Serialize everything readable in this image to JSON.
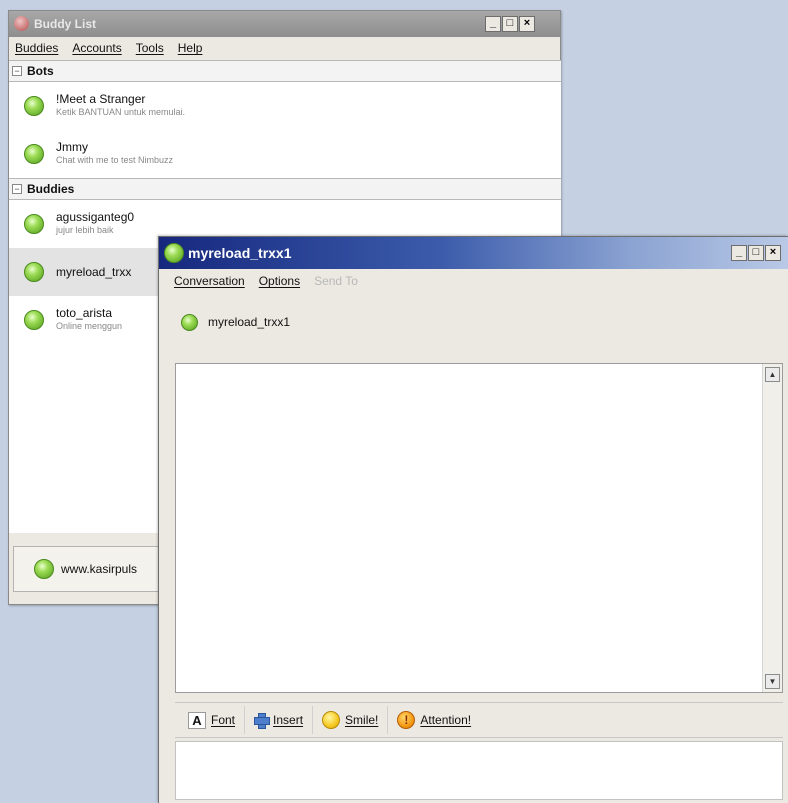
{
  "buddy_list_window": {
    "title": "Buddy List",
    "controls": {
      "minimize": "_",
      "maximize": "□",
      "close": "×"
    },
    "menu": [
      "Buddies",
      "Accounts",
      "Tools",
      "Help"
    ],
    "groups": [
      {
        "name": "Bots",
        "collapse_glyph": "−",
        "buddies": [
          {
            "name": "!Meet a Stranger",
            "status": "Ketik BANTUAN untuk memulai."
          },
          {
            "name": "Jmmy",
            "status": "Chat with me to test Nimbuzz"
          }
        ]
      },
      {
        "name": "Buddies",
        "collapse_glyph": "−",
        "buddies": [
          {
            "name": "agussiganteg0",
            "status": "jujur lebih baik"
          },
          {
            "name": "myreload_trxx",
            "status": "",
            "selected": true
          },
          {
            "name": "toto_arista",
            "status": "Online menggun"
          }
        ]
      }
    ],
    "status_bar": {
      "text": "www.kasirpuls"
    }
  },
  "conversation_window": {
    "title": "myreload_trxx1",
    "controls": {
      "minimize": "_",
      "maximize": "□",
      "close": "×"
    },
    "menu": [
      {
        "label": "Conversation",
        "enabled": true
      },
      {
        "label": "Options",
        "enabled": true
      },
      {
        "label": "Send To",
        "enabled": false
      }
    ],
    "contact_name": "myreload_trxx1",
    "scroll_up_glyph": "▲",
    "scroll_down_glyph": "▼",
    "toolbar": {
      "font": {
        "glyph": "A",
        "label": "Font"
      },
      "insert": {
        "label": "Insert"
      },
      "smile": {
        "label": "Smile!"
      },
      "attention": {
        "glyph": "!",
        "label": "Attention!"
      }
    }
  },
  "colors": {
    "online_green": "#7cc63c",
    "active_titlebar": "#16287e",
    "inactive_titlebar": "#9a9a9a"
  }
}
